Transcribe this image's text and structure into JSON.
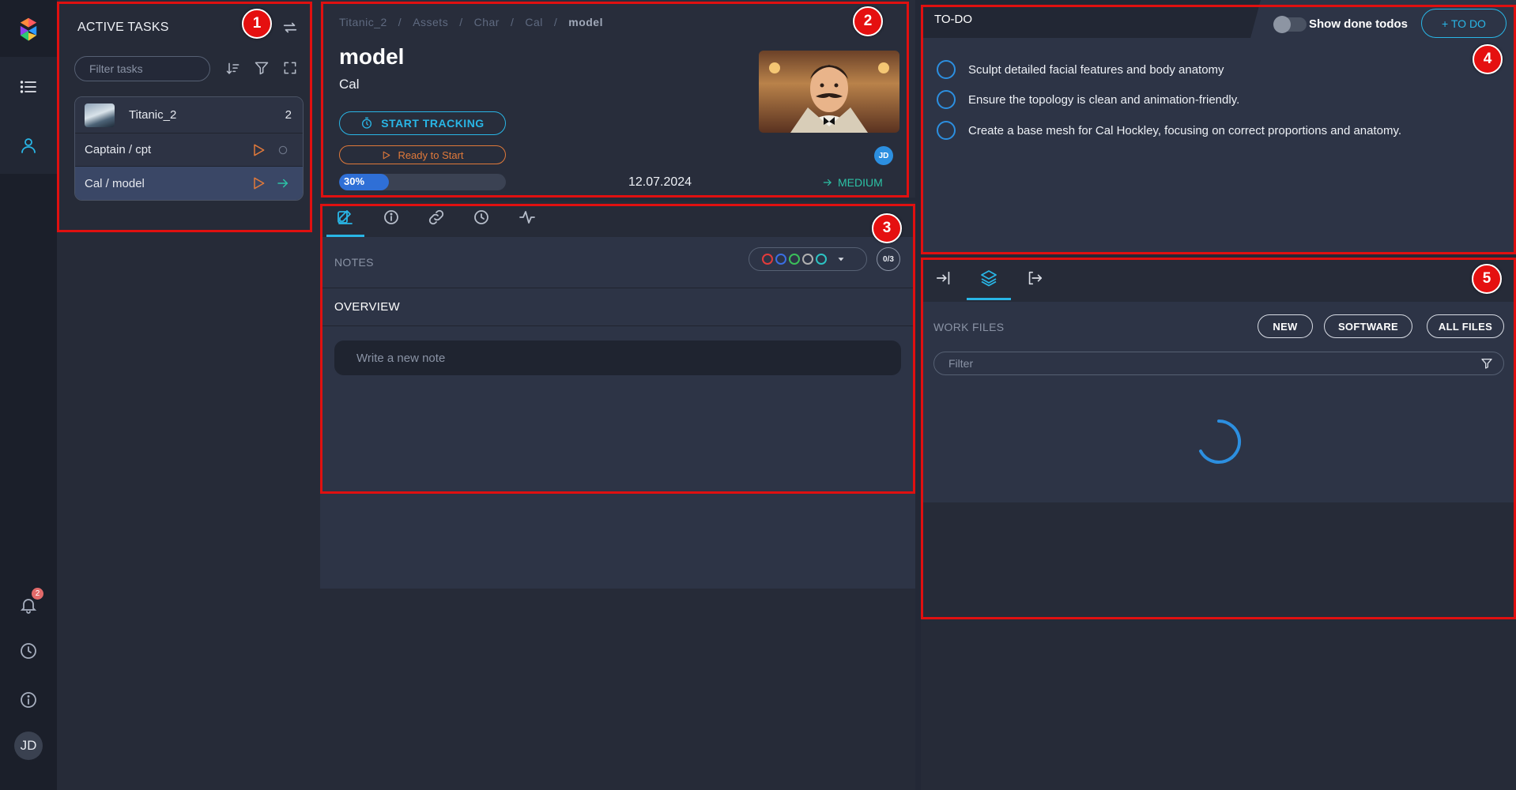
{
  "rail": {
    "avatar": "JD",
    "notification_count": "2"
  },
  "tasks_panel": {
    "title": "ACTIVE TASKS",
    "filter_placeholder": "Filter tasks",
    "project": {
      "name": "Titanic_2",
      "count": "2"
    },
    "tasks": [
      {
        "label": "Captain / cpt",
        "selected": false
      },
      {
        "label": "Cal / model",
        "selected": true
      }
    ]
  },
  "header": {
    "breadcrumb": [
      "Titanic_2",
      "Assets",
      "Char",
      "Cal",
      "model"
    ],
    "title": "model",
    "subtitle": "Cal",
    "start_tracking_label": "START TRACKING",
    "status_label": "Ready to Start",
    "progress_label": "30%",
    "progress": 0.3,
    "due_date": "12.07.2024",
    "priority": "MEDIUM",
    "assignee": "JD"
  },
  "notes": {
    "section_label": "NOTES",
    "count": "0/3",
    "overview_label": "OVERVIEW",
    "note_placeholder": "Write a new note",
    "color_filters": [
      "#e23b3b",
      "#3b6ee2",
      "#3bbf5a",
      "#b0b0b0",
      "#2cc3c3"
    ]
  },
  "todo": {
    "title": "TO-DO",
    "show_done_label": "Show done todos",
    "add_label": "+ TO DO",
    "items": [
      "Sculpt detailed facial features and body anatomy",
      "Ensure the topology is clean and animation-friendly.",
      "Create a base mesh for Cal Hockley, focusing on correct proportions and anatomy."
    ]
  },
  "files": {
    "section_label": "WORK FILES",
    "new_label": "NEW",
    "software_label": "SOFTWARE",
    "all_files_label": "ALL FILES",
    "filter_placeholder": "Filter"
  },
  "annotations": [
    "1",
    "2",
    "3",
    "4",
    "5"
  ]
}
